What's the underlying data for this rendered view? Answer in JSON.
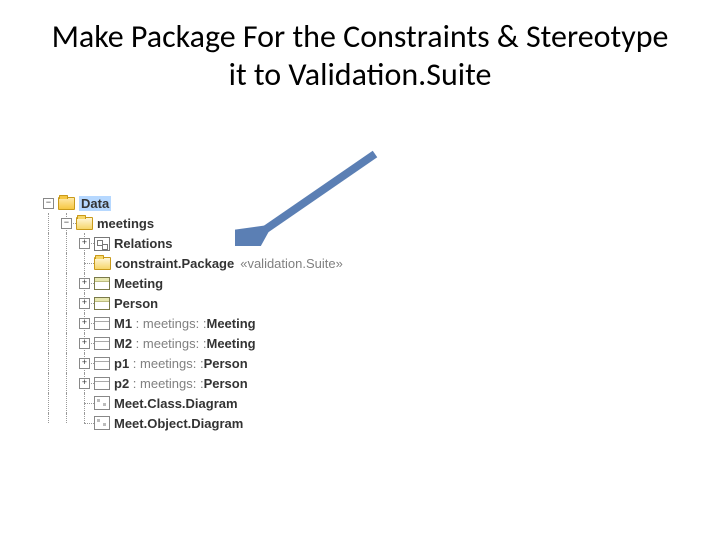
{
  "title": "Make Package For the Constraints & Stereotype it to Validation.Suite",
  "tree": {
    "root": {
      "label": "Data"
    },
    "meetings": {
      "label": "meetings"
    },
    "relations": {
      "label": "Relations"
    },
    "constraint_pkg": {
      "label": "constraint.Package",
      "stereotype": "«validation.Suite»"
    },
    "meeting_cls": {
      "label": "Meeting"
    },
    "person_cls": {
      "label": "Person"
    },
    "m1": {
      "name": "M1",
      "path": " : meetings: :",
      "type": "Meeting"
    },
    "m2": {
      "name": "M2",
      "path": " : meetings: :",
      "type": "Meeting"
    },
    "p1": {
      "name": "p1",
      "path": " : meetings: :",
      "type": "Person"
    },
    "p2": {
      "name": "p2",
      "path": " : meetings: :",
      "type": "Person"
    },
    "class_diag": {
      "label": "Meet.Class.Diagram"
    },
    "obj_diag": {
      "label": "Meet.Object.Diagram"
    }
  }
}
